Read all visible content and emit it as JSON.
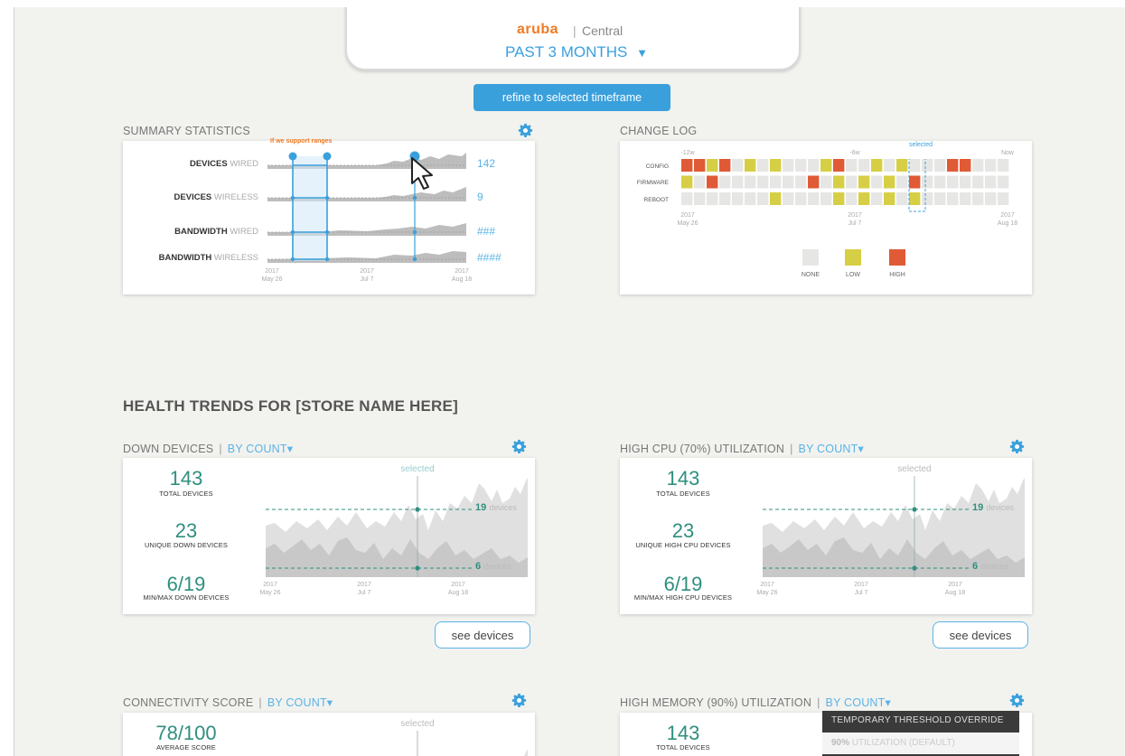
{
  "header": {
    "brand": "aruba",
    "brand_sub": "Central",
    "timeframe": "PAST 3 MONTHS",
    "dropdown_glyph": "▼",
    "refine_button": "refine to selected timeframe"
  },
  "summary": {
    "title": "SUMMARY STATISTICS",
    "annotation": "If we support ranges",
    "rows": [
      {
        "bold": "DEVICES",
        "light": "WIRED",
        "value": "142"
      },
      {
        "bold": "DEVICES",
        "light": "WIRELESS",
        "value": "9"
      },
      {
        "bold": "BANDWIDTH",
        "light": "WIRED",
        "value": "###"
      },
      {
        "bold": "BANDWIDTH",
        "light": "WIRELESS",
        "value": "####"
      }
    ],
    "ticks": [
      {
        "year": "2017",
        "date": "May 26"
      },
      {
        "year": "2017",
        "date": "Jul 7"
      },
      {
        "year": "2017",
        "date": "Aug 18"
      }
    ]
  },
  "changelog": {
    "title": "CHANGE LOG",
    "top_ticks": [
      "-12w",
      "-6w",
      "selected",
      "Now"
    ],
    "rows": [
      {
        "label": "CONFIG",
        "cells": [
          2,
          2,
          1,
          2,
          0,
          1,
          0,
          1,
          0,
          0,
          0,
          1,
          2,
          0,
          0,
          1,
          0,
          1,
          0,
          0,
          0,
          2,
          2,
          0,
          0,
          0
        ]
      },
      {
        "label": "FIRMWARE",
        "cells": [
          1,
          0,
          2,
          0,
          0,
          0,
          0,
          0,
          0,
          0,
          2,
          0,
          1,
          0,
          1,
          0,
          1,
          0,
          2,
          0,
          0,
          0,
          0,
          0,
          0,
          0
        ]
      },
      {
        "label": "REBOOT",
        "cells": [
          0,
          0,
          0,
          0,
          0,
          0,
          0,
          1,
          0,
          0,
          0,
          0,
          1,
          0,
          1,
          0,
          1,
          0,
          1,
          0,
          0,
          0,
          0,
          0,
          0,
          0
        ]
      }
    ],
    "bottom_ticks": [
      {
        "year": "2017",
        "date": "May 26"
      },
      {
        "year": "2017",
        "date": "Jul 7"
      },
      {
        "year": "2017",
        "date": "Aug 18"
      }
    ],
    "legend": [
      {
        "label": "NONE",
        "color": "#e6e6e4"
      },
      {
        "label": "LOW",
        "color": "#d6cf45"
      },
      {
        "label": "HIGH",
        "color": "#e05a35"
      }
    ]
  },
  "health": {
    "title": "HEALTH TRENDS FOR [STORE NAME HERE]",
    "by_count": "BY COUNT▾",
    "down_devices": {
      "title": "DOWN DEVICES",
      "stats": [
        {
          "value": "143",
          "label": "TOTAL DEVICES"
        },
        {
          "value": "23",
          "label": "UNIQUE DOWN DEVICES"
        },
        {
          "value": "6/19",
          "label": "MIN/MAX DOWN DEVICES"
        }
      ],
      "selected": "selected",
      "max_value": "19",
      "max_unit": "devices",
      "min_value": "6",
      "min_unit": "devices",
      "ticks": [
        {
          "year": "2017",
          "date": "May 26"
        },
        {
          "year": "2017",
          "date": "Jul 7"
        },
        {
          "year": "2017",
          "date": "Aug 18"
        }
      ],
      "button": "see devices"
    },
    "high_cpu": {
      "title": "HIGH CPU (70%) UTILIZATION",
      "stats": [
        {
          "value": "143",
          "label": "TOTAL DEVICES"
        },
        {
          "value": "23",
          "label": "UNIQUE HIGH CPU DEVICES"
        },
        {
          "value": "6/19",
          "label": "MIN/MAX HIGH CPU DEVICES"
        }
      ],
      "selected": "selected",
      "max_value": "19",
      "max_unit": "devices",
      "min_value": "6",
      "min_unit": "devices",
      "ticks": [
        {
          "year": "2017",
          "date": "May 26"
        },
        {
          "year": "2017",
          "date": "Jul 7"
        },
        {
          "year": "2017",
          "date": "Aug 18"
        }
      ],
      "button": "see devices"
    },
    "connectivity": {
      "title": "CONNECTIVITY SCORE",
      "value": "78/100",
      "label": "AVERAGE SCORE",
      "selected": "selected"
    },
    "high_memory": {
      "title": "HIGH MEMORY (90%) UTILIZATION",
      "value": "143",
      "label": "TOTAL DEVICES",
      "override_title": "TEMPORARY THRESHOLD OVERRIDE",
      "override_item_strong": "90%",
      "override_item": "UTILIZATION (DEFAULT)"
    }
  },
  "colors": {
    "accent": "#5ab4e6",
    "teal": "#2f8f7f",
    "orange": "#f07a23",
    "low": "#d6cf45",
    "high": "#e05a35"
  }
}
